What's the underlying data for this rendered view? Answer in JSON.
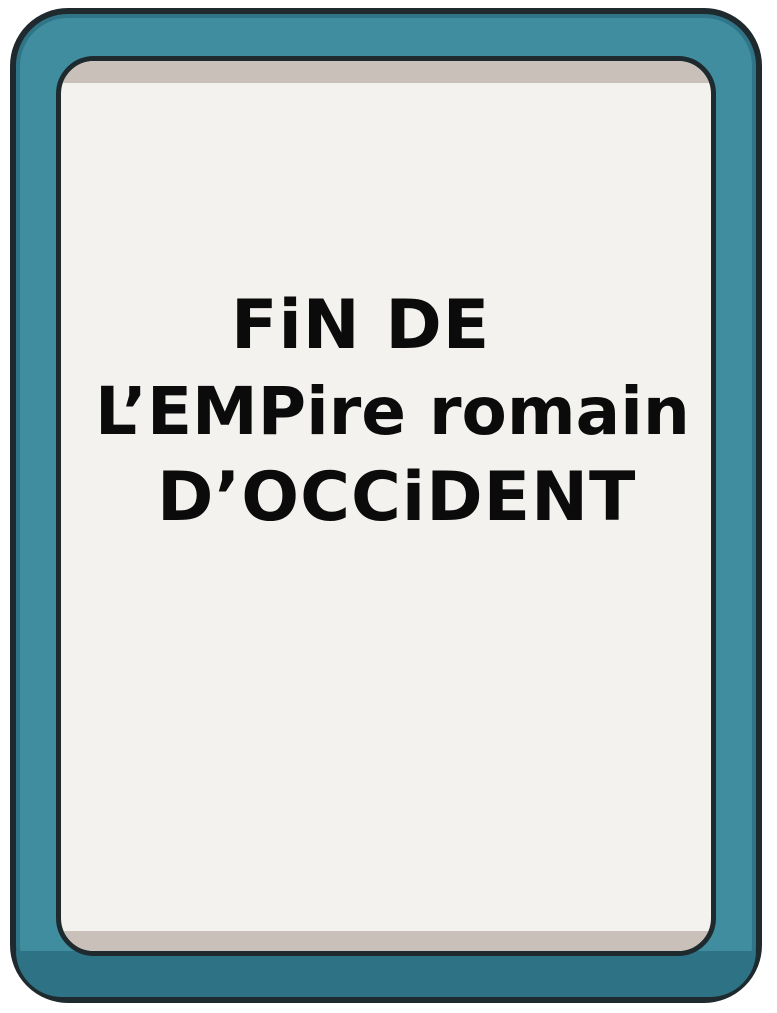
{
  "card": {
    "title_lines": [
      "FiN DE",
      "L’EMPire romain",
      "D’OCCiDENT"
    ]
  },
  "colors": {
    "frame": "#3f8d9f",
    "frame_dark": "#2e7385",
    "outline": "#1e2a2e",
    "paper": "#f3f2ef",
    "paper_shade": "#c9c1b9",
    "ink": "#0b0b0b"
  }
}
